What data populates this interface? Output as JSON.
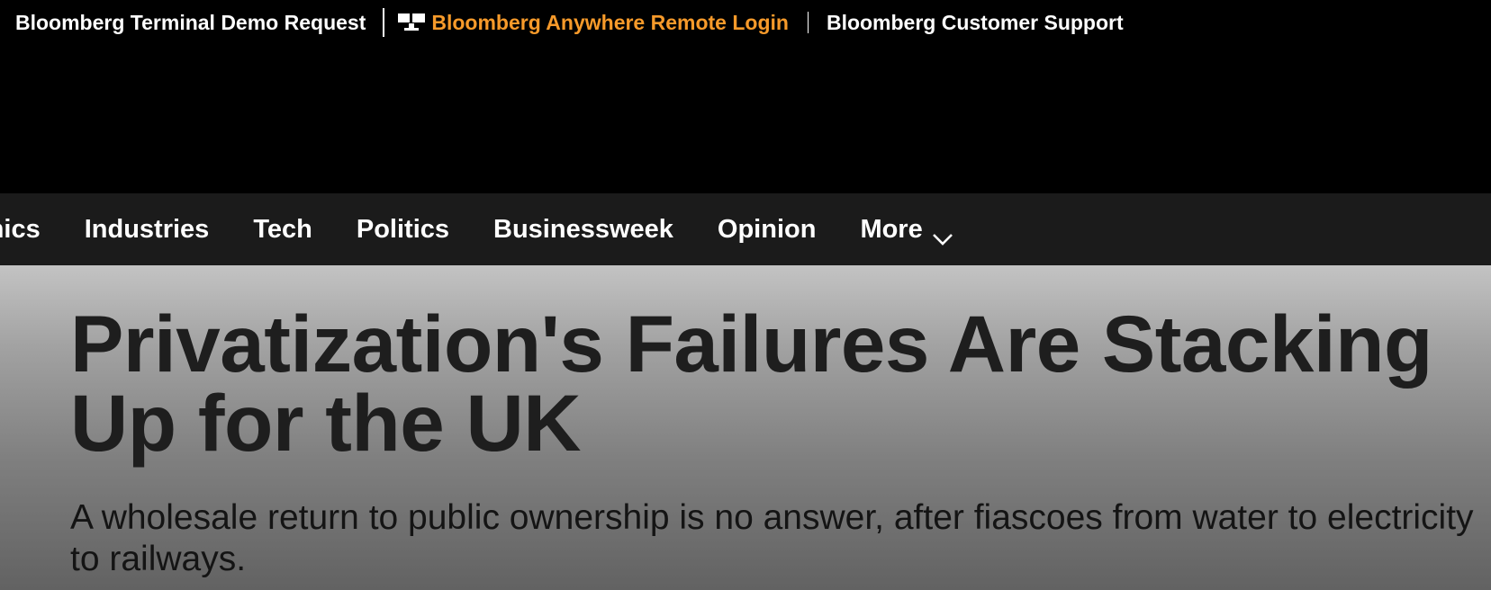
{
  "topbar": {
    "demo_request": "Bloomberg Terminal Demo Request",
    "anywhere_login": "Bloomberg Anywhere Remote Login",
    "customer_support": "Bloomberg Customer Support",
    "anywhere_color": "#f79a2a",
    "terminal_icon": "terminal-icon"
  },
  "nav": {
    "items": [
      {
        "label": "Economics"
      },
      {
        "label": "Industries"
      },
      {
        "label": "Tech"
      },
      {
        "label": "Politics"
      },
      {
        "label": "Businessweek"
      },
      {
        "label": "Opinion"
      }
    ],
    "more_label": "More",
    "more_icon": "chevron-down-icon"
  },
  "article": {
    "headline": "Privatization's Failures Are Stacking Up for the UK",
    "dek": "A wholesale return to public ownership is no answer, after fiascoes from water to electricity to railways."
  }
}
